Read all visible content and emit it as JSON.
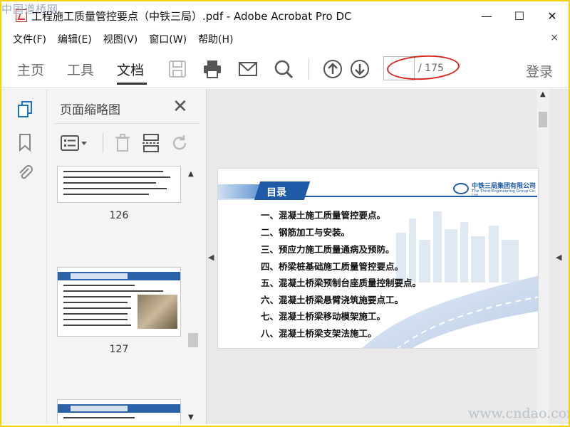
{
  "watermark_top": "中国道桥网",
  "watermark_bottom": "www.cndao.com",
  "window": {
    "title": "工程施工质量管控要点（中铁三局）.pdf - Adobe Acrobat Pro DC",
    "minimize": "—",
    "maximize": "☐",
    "close": "✕"
  },
  "menu": {
    "items": [
      "文件(F)",
      "编辑(E)",
      "视图(V)",
      "窗口(W)",
      "帮助(H)"
    ],
    "close": "×"
  },
  "toolbar": {
    "tabs": [
      "主页",
      "工具",
      "文档"
    ],
    "active_tab": "文档",
    "page_current": "",
    "page_total": "/ 175",
    "login": "登录",
    "icons": [
      "save-icon",
      "print-icon",
      "email-icon",
      "search-icon",
      "page-up-icon",
      "page-down-icon"
    ]
  },
  "left_rail": {
    "icons": [
      "page-thumbnails-icon",
      "bookmark-icon",
      "attachment-icon"
    ]
  },
  "thumb_panel": {
    "title": "页面缩略图",
    "close": "✕",
    "tools": [
      "thumbnail-options-icon",
      "delete-icon",
      "insert-page-icon",
      "rotate-icon"
    ],
    "pages": [
      "126",
      "127"
    ]
  },
  "slide": {
    "heading": "目录",
    "company_cn": "中铁三局集团有限公司",
    "company_en": "The Third Engineering Group Co. Ltd.",
    "toc": [
      "一、混凝土施工质量管控要点。",
      "二、钢筋加工与安装。",
      "三、预应力施工质量通病及预防。",
      "四、桥梁桩基础施工质量管控要点。",
      "五、混凝土桥梁预制台座质量控制要点。",
      "六、混凝土桥梁悬臂浇筑施要点工。",
      "七、混凝土桥梁移动模架施工。",
      "八、混凝土桥梁支架法施工。"
    ]
  }
}
